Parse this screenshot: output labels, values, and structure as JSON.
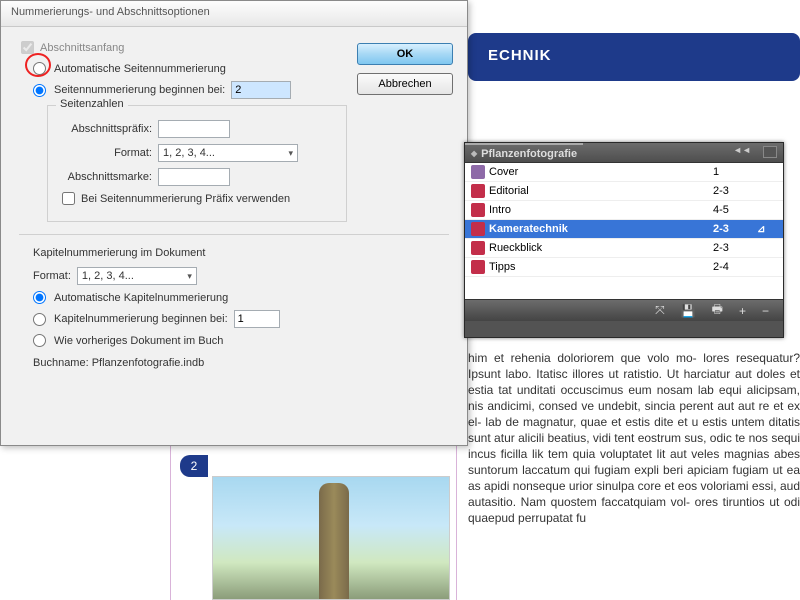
{
  "page_badge": "2",
  "header_banner": "ECHNIK",
  "body_text": "him et rehenia doloriorem que volo mo- lores resequatur? Ipsunt labo. Itatisc illores ut ratistio. Ut harciatur aut doles et estia tat unditati occuscimus eum nosam lab equi alicipsam, nis andicimi, consed ve undebit, sincia perent aut aut re et ex el- lab de magnatur, quae et estis dite et u estis untem ditatis sunt atur alicili beatius, vidi tent eostrum sus, odic te nos sequi incus ficilla lik tem quia voluptatet lit aut veles magnias abes suntorum laccatum qui fugiam expli beri apiciam fugiam ut ea as apidi nonseque urior sinulpa core et eos voloriami essi, aud autasitio. Nam quostem faccatquiam vol- ores tiruntios ut odi quaepud perrupatat fu",
  "dialog": {
    "title": "Nummerierungs- und Abschnittsoptionen",
    "buttons": {
      "ok": "OK",
      "cancel": "Abbrechen"
    },
    "section_start": "Abschnittsanfang",
    "auto_page": "Automatische Seitennummerierung",
    "start_at_label": "Seitennummerierung beginnen bei:",
    "start_at_value": "2",
    "page_numbers": {
      "legend": "Seitenzahlen",
      "prefix_label": "Abschnittspräfix:",
      "format_label": "Format:",
      "format_value": "1, 2, 3, 4...",
      "marker_label": "Abschnittsmarke:",
      "use_prefix": "Bei Seitennummerierung Präfix verwenden"
    },
    "chapter": {
      "title": "Kapitelnummerierung im Dokument",
      "format_label": "Format:",
      "format_value": "1, 2, 3, 4...",
      "auto": "Automatische Kapitelnummerierung",
      "start_at_label": "Kapitelnummerierung beginnen bei:",
      "start_at_value": "1",
      "as_prev": "Wie vorheriges Dokument im Buch",
      "bookname_label": "Buchname: ",
      "bookname_value": "Pflanzenfotografie.indb"
    }
  },
  "book": {
    "title": "Pflanzenfotografie",
    "rows": [
      {
        "name": "Cover",
        "range": "1",
        "flag": ""
      },
      {
        "name": "Editorial",
        "range": "2-3",
        "flag": ""
      },
      {
        "name": "Intro",
        "range": "4-5",
        "flag": ""
      },
      {
        "name": "Kameratechnik",
        "range": "2-3",
        "flag": "⊿"
      },
      {
        "name": "Rueckblick",
        "range": "2-3",
        "flag": ""
      },
      {
        "name": "Tipps",
        "range": "2-4",
        "flag": ""
      }
    ],
    "footer_icons": {
      "sync": "⤧",
      "save": "💾",
      "print": "🖶",
      "add": "+",
      "remove": "−"
    }
  }
}
